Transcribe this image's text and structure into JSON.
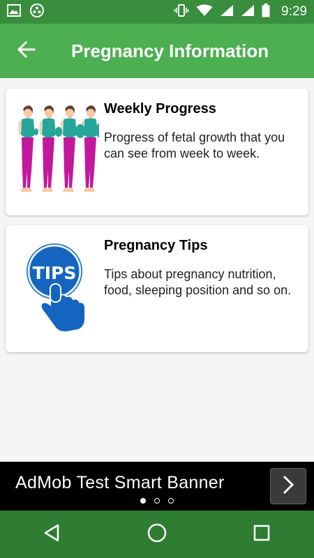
{
  "status_bar": {
    "time": "9:29",
    "icons_left": [
      "image-icon",
      "app-notification-icon"
    ],
    "icons_right": [
      "vibrate-icon",
      "wifi-icon",
      "signal-icon",
      "signal-icon",
      "battery-icon"
    ]
  },
  "app_bar": {
    "title": "Pregnancy Information",
    "back_icon": "arrow-left-icon"
  },
  "cards": [
    {
      "title": "Weekly Progress",
      "description": "Progress of fetal growth that you can see from week to week.",
      "image": "pregnant-women-illustration"
    },
    {
      "title": "Pregnancy Tips",
      "description": "Tips about pregnancy nutrition, food, sleeping position and so on.",
      "image": "tips-hand-icon",
      "image_text": "TIPS"
    }
  ],
  "ad_banner": {
    "text": "AdMob Test Smart Banner",
    "page_count": 3,
    "active_page": 1
  },
  "nav_bar": {
    "buttons": [
      "back-icon",
      "home-icon",
      "recents-icon"
    ]
  },
  "colors": {
    "status_bar": "#388e3c",
    "app_bar": "#4caf50",
    "nav_bar": "#2e7d32",
    "tips_blue": "#1565c0",
    "shirt": "#26a69a",
    "pants": "#c2189c"
  }
}
